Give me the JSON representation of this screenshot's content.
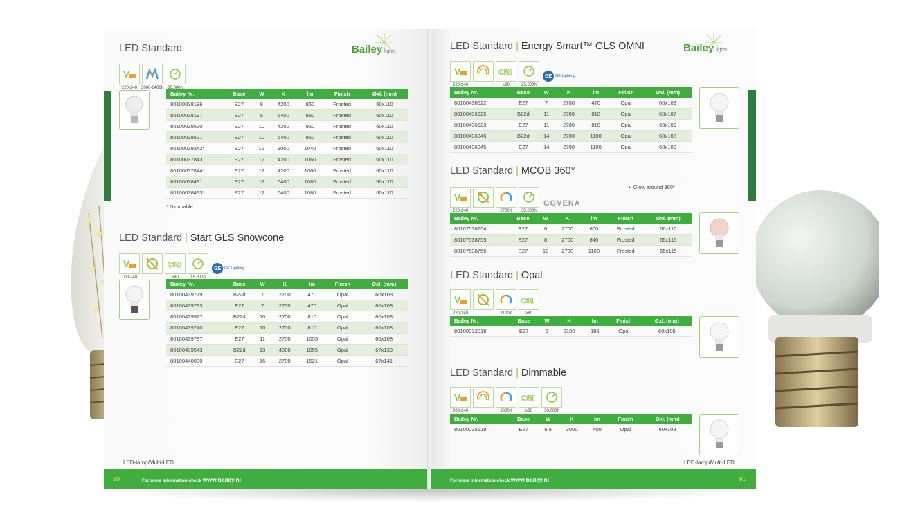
{
  "brand": {
    "name": "Bailey",
    "tag": "lights"
  },
  "left_page": {
    "number": "90",
    "footer_label": "LED-lamp/Multi-LED",
    "footer_prefix": "For more information check",
    "footer_url": "www.bailey.nl",
    "sections": [
      {
        "title": "LED Standard",
        "subtitle": "",
        "icons": [
          {
            "name": "voltage-icon",
            "caption": "220-240"
          },
          {
            "name": "dual-color-icon",
            "caption": "3000-6400K"
          },
          {
            "name": "lifetime-icon",
            "caption": "30.000h"
          }
        ],
        "headers": [
          "Bailey Nr.",
          "Base",
          "W",
          "K",
          "lm",
          "Finish",
          "Øxl. (mm)"
        ],
        "rows": [
          [
            "80100038196",
            "E27",
            "8",
            "4200",
            "860",
            "Frosted",
            "60x110"
          ],
          [
            "80100038197",
            "E27",
            "8",
            "6400",
            "880",
            "Frosted",
            "60x110"
          ],
          [
            "80100038520",
            "E27",
            "10",
            "4200",
            "950",
            "Frosted",
            "60x110"
          ],
          [
            "80100038521",
            "E27",
            "10",
            "6400",
            "950",
            "Frosted",
            "60x110"
          ],
          [
            "80100039342*",
            "E27",
            "12",
            "3000",
            "1040",
            "Frosted",
            "60x110"
          ],
          [
            "80100037843",
            "E27",
            "12",
            "4200",
            "1060",
            "Frosted",
            "60x110"
          ],
          [
            "80100037844*",
            "E27",
            "12",
            "4200",
            "1060",
            "Frosted",
            "60x110"
          ],
          [
            "80100038491",
            "E27",
            "12",
            "6400",
            "1080",
            "Frosted",
            "60x110"
          ],
          [
            "80100038493*",
            "E27",
            "12",
            "6400",
            "1080",
            "Frosted",
            "60x110"
          ]
        ],
        "note": "* Dimmable"
      },
      {
        "title": "LED Standard",
        "subtitle": "Start GLS Snowcone",
        "icons": [
          {
            "name": "voltage-icon",
            "caption": "100-240"
          },
          {
            "name": "non-dimmable-icon",
            "caption": ""
          },
          {
            "name": "cri-icon",
            "caption": "≥80"
          },
          {
            "name": "lifetime-icon",
            "caption": "15.000h"
          }
        ],
        "brand_logo": "GE Lighting",
        "headers": [
          "Bailey Nr.",
          "Base",
          "W",
          "K",
          "lm",
          "Finish",
          "Øxl. (mm)"
        ],
        "rows": [
          [
            "80100439779",
            "B22d",
            "7",
            "2700",
            "470",
            "Opal",
            "60x108"
          ],
          [
            "80100439783",
            "E27",
            "7",
            "2700",
            "470",
            "Opal",
            "60x108"
          ],
          [
            "80100439927",
            "B22d",
            "10",
            "2700",
            "810",
            "Opal",
            "60x108"
          ],
          [
            "80100439740",
            "E27",
            "10",
            "2700",
            "810",
            "Opal",
            "60x108"
          ],
          [
            "80100439787",
            "E27",
            "11",
            "2700",
            "1055",
            "Opal",
            "60x108"
          ],
          [
            "80100439543",
            "B22d",
            "13",
            "4000",
            "1055",
            "Opal",
            "67x139"
          ],
          [
            "80100440090",
            "E27",
            "16",
            "2700",
            "1521",
            "Opal",
            "67x141"
          ]
        ]
      }
    ]
  },
  "right_page": {
    "number": "91",
    "footer_label": "LED-lamp/Multi-LED",
    "footer_prefix": "For more information check",
    "footer_url": "www.bailey.nl",
    "sections": [
      {
        "title": "LED Standard",
        "subtitle": "Energy Smart™ GLS OMNI",
        "icons": [
          {
            "name": "voltage-icon",
            "caption": "220-240"
          },
          {
            "name": "dimmable-icon",
            "caption": ""
          },
          {
            "name": "cri-icon",
            "caption": "≥80"
          },
          {
            "name": "lifetime-icon",
            "caption": "25.000h"
          }
        ],
        "brand_logo": "GE Lighting",
        "headers": [
          "Bailey Nr.",
          "Base",
          "W",
          "K",
          "lm",
          "Finish",
          "Øxl. (mm)"
        ],
        "rows": [
          [
            "80100436522",
            "E27",
            "7",
            "2700",
            "470",
            "Opal",
            "60x109"
          ],
          [
            "80100436525",
            "B22d",
            "11",
            "2700",
            "810",
            "Opal",
            "60x107"
          ],
          [
            "80100436523",
            "E27",
            "11",
            "2700",
            "810",
            "Opal",
            "60x109"
          ],
          [
            "80100436346",
            "B22d",
            "14",
            "2700",
            "1100",
            "Opal",
            "60x108"
          ],
          [
            "80100436345",
            "E27",
            "14",
            "2700",
            "1100",
            "Opal",
            "60x109"
          ]
        ]
      },
      {
        "title": "LED Standard",
        "subtitle": "MCOB 360°",
        "bullet": "Glow around 360°",
        "icons": [
          {
            "name": "voltage-icon",
            "caption": "220-240"
          },
          {
            "name": "non-dimmable-icon",
            "caption": ""
          },
          {
            "name": "color-temp-icon",
            "caption": "2700K"
          },
          {
            "name": "lifetime-icon",
            "caption": "35.000h"
          }
        ],
        "brand_logo": "GOVENA",
        "headers": [
          "Bailey Nr.",
          "Base",
          "W",
          "K",
          "lm",
          "Finish",
          "Øxl. (mm)"
        ],
        "rows": [
          [
            "80107538754",
            "E27",
            "6",
            "2700",
            "600",
            "Frosted",
            "60x110"
          ],
          [
            "80107538755",
            "E27",
            "8",
            "2700",
            "840",
            "Frosted",
            "65x115"
          ],
          [
            "80107538756",
            "E27",
            "10",
            "2700",
            "1100",
            "Frosted",
            "65x115"
          ]
        ]
      },
      {
        "title": "LED Standard",
        "subtitle": "Opal",
        "icons": [
          {
            "name": "voltage-icon",
            "caption": "220-240"
          },
          {
            "name": "non-dimmable-icon",
            "caption": ""
          },
          {
            "name": "color-temp-icon",
            "caption": "2100K"
          },
          {
            "name": "cri-icon",
            "caption": "≥80"
          }
        ],
        "headers": [
          "Bailey Nr.",
          "Base",
          "W",
          "K",
          "lm",
          "Finish",
          "Øxl. (mm)"
        ],
        "rows": [
          [
            "80100032018",
            "E27",
            "2",
            "2100",
            "195",
            "Opal",
            "60x105"
          ]
        ]
      },
      {
        "title": "LED Standard",
        "subtitle": "Dimmable",
        "icons": [
          {
            "name": "voltage-icon",
            "caption": "200-240"
          },
          {
            "name": "dimmable-icon",
            "caption": ""
          },
          {
            "name": "color-temp-icon",
            "caption": "3000K"
          },
          {
            "name": "cri-icon",
            "caption": "≥80"
          },
          {
            "name": "lifetime-icon",
            "caption": "30.000h"
          }
        ],
        "headers": [
          "Bailey Nr.",
          "Base",
          "W",
          "K",
          "lm",
          "Finish",
          "Øxl. (mm)"
        ],
        "rows": [
          [
            "80100035619",
            "E27",
            "6.5",
            "3000",
            "400",
            "Opal",
            "60x108"
          ]
        ]
      }
    ]
  },
  "colors": {
    "green": "#3fae3f",
    "dark_green": "#2f7d3a",
    "alt_row": "#e3eedb",
    "accent_text": "#8cc63f"
  }
}
